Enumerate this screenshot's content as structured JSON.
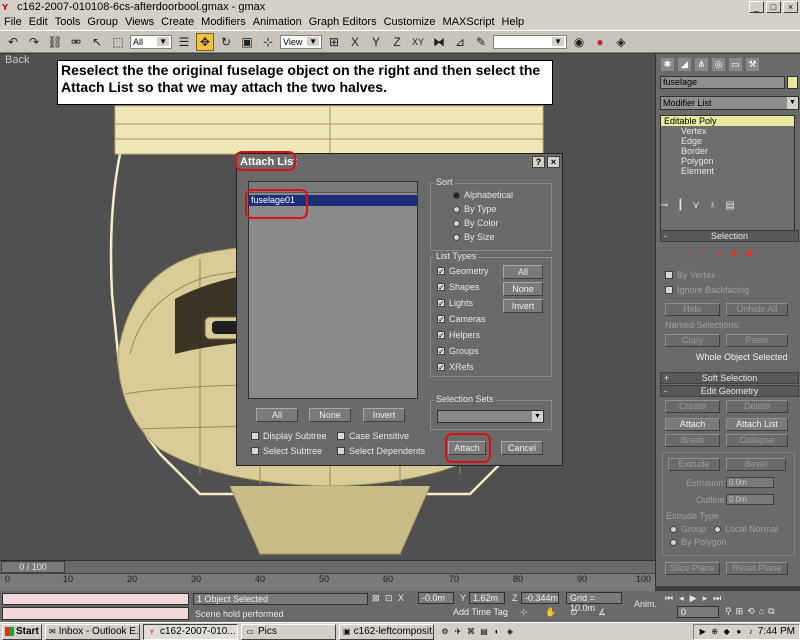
{
  "window": {
    "title": "c162-2007-010108-6cs-afterdoorbool.gmax - gmax",
    "minimize": "_",
    "maximize": "□",
    "close": "×"
  },
  "menu": [
    "File",
    "Edit",
    "Tools",
    "Group",
    "Views",
    "Create",
    "Modifiers",
    "Animation",
    "Graph Editors",
    "Customize",
    "MAXScript",
    "Help"
  ],
  "toolbar": {
    "filter_value": "All",
    "view_value": "View"
  },
  "viewport": {
    "label": "Back"
  },
  "annotation": {
    "text": "Reselect the the original fuselage object on the right and then select the Attach List so that we may attach the two halves."
  },
  "dialog": {
    "title": "Attach List",
    "help_btn": "?",
    "close_btn": "×",
    "list_items": [
      "fuselage01"
    ],
    "sort": {
      "label": "Sort",
      "options": [
        "Alphabetical",
        "By Type",
        "By Color",
        "By Size"
      ],
      "selected": "Alphabetical"
    },
    "list_types": {
      "label": "List Types",
      "items": [
        "Geometry",
        "Shapes",
        "Lights",
        "Cameras",
        "Helpers",
        "Groups",
        "XRefs"
      ],
      "buttons": [
        "All",
        "None",
        "Invert"
      ]
    },
    "selection_sets": {
      "label": "Selection Sets"
    },
    "bottom_buttons": [
      "All",
      "None",
      "Invert"
    ],
    "options": [
      "Display Subtree",
      "Case Sensitive",
      "Select Subtree",
      "Select Dependents"
    ],
    "attach": "Attach",
    "cancel": "Cancel"
  },
  "command_panel": {
    "object_name": "fuselage",
    "modifier_list": "Modifier List",
    "stack_top": "Editable Poly",
    "stack_subs": [
      "Vertex",
      "Edge",
      "Border",
      "Polygon",
      "Element"
    ],
    "selection": {
      "rollout": "Selection",
      "by_vertex": "By Vertex",
      "ignore_backfacing": "Ignore Backfacing",
      "hide": "Hide",
      "unhide_all": "Unhide All",
      "named_selections": "Named Selections:",
      "copy": "Copy",
      "paste": "Paste",
      "status": "Whole Object Selected"
    },
    "soft_selection": "Soft Selection",
    "edit_geometry": {
      "rollout": "Edit Geometry",
      "create": "Create",
      "delete": "Delete",
      "attach": "Attach",
      "attach_list": "Attach List",
      "break": "Break",
      "collapse": "Collapse",
      "extrude": "Extrude",
      "bevel": "Bevel",
      "extrusion_label": "Extrusion:",
      "extrusion_value": "0.0m",
      "outline_label": "Outline:",
      "outline_value": "0.0m",
      "extrude_type": "Extrude Type",
      "group": "Group",
      "local_normal": "Local Normal",
      "by_polygon": "By Polygon",
      "slice_plane": "Slice Plane",
      "reset_plane": "Reset Plane"
    }
  },
  "timeline": {
    "slider": "0 / 100",
    "labels": [
      "0",
      "10",
      "20",
      "30",
      "40",
      "50",
      "60",
      "70",
      "80",
      "90",
      "100"
    ]
  },
  "status": {
    "selected": "1 Object Selected",
    "prompt": "Scene hold performed",
    "x_label": "X",
    "x_value": "-0.0m",
    "y_label": "Y",
    "y_value": "1.62m",
    "z_label": "Z",
    "z_value": "-0.344m",
    "grid": "Grid = 10.0m",
    "add_time_tag": "Add Time Tag",
    "anim": "Anim.",
    "frame": "0"
  },
  "taskbar": {
    "start": "Start",
    "tasks": [
      "Inbox - Outlook E...",
      "c162-2007-010...",
      "Pics",
      "c162-leftcomposit..."
    ],
    "clock": "7:44 PM"
  }
}
